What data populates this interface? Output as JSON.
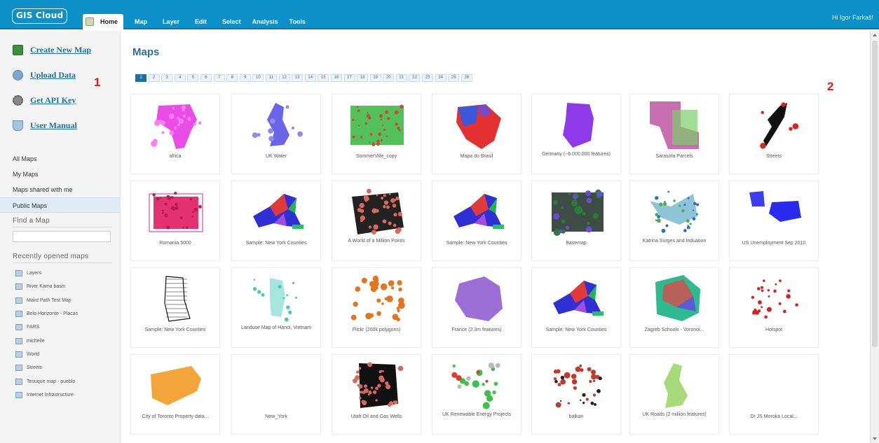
{
  "app": {
    "logo": "GIS Cloud",
    "tabs": [
      {
        "label": "Home"
      },
      {
        "label": "Map"
      },
      {
        "label": "Layer"
      },
      {
        "label": "Edit"
      },
      {
        "label": "Select"
      },
      {
        "label": "Analysis"
      },
      {
        "label": "Tools"
      }
    ],
    "user_greeting": "Hi Igor Farkaš!"
  },
  "colors": {
    "accent": "#0d90c8",
    "link": "#1a6fa3",
    "marker": "#e11b1b"
  },
  "sidebar": {
    "actions": [
      {
        "label": "Create New Map",
        "icon": "create-map-icon"
      },
      {
        "label": "Upload Data",
        "icon": "upload-icon"
      },
      {
        "label": "Get API Key",
        "icon": "gear-icon"
      },
      {
        "label": "User Manual",
        "icon": "book-icon"
      }
    ],
    "marker": "1",
    "nav": [
      {
        "label": "All Maps"
      },
      {
        "label": "My Maps"
      },
      {
        "label": "Maps shared with me"
      },
      {
        "label": "Public Maps"
      }
    ],
    "find_title": "Find a Map",
    "find_value": "",
    "recent_title": "Recently opened maps",
    "recent": [
      "Layers",
      "River Kama basin",
      "Maint Path Test Map",
      "Belo Horizonte - Placas",
      "FARS",
      "michelle",
      "World",
      "Streets",
      "Tesuque map - pueblo",
      "Internet Infrastructure"
    ]
  },
  "main": {
    "title": "Maps",
    "marker": "2",
    "pages": [
      "1",
      "2",
      "3",
      "4",
      "5",
      "6",
      "7",
      "8",
      "9",
      "10",
      "11",
      "12",
      "13",
      "14",
      "15",
      "16",
      "17",
      "18",
      "19",
      "20",
      "21",
      "22",
      "23",
      "24",
      "25",
      "26"
    ],
    "current_page": "1",
    "maps": [
      "africa",
      "UK Water",
      "SommerVille_copy",
      "Mapa do Brasil",
      "Germany (~6.000.000 features)",
      "Sarasota Parcels",
      "Streets",
      "Romania 5000",
      "Sample: New York Counties",
      "A World of a Million Points",
      "Sample: New York Counties",
      "Basemap",
      "Katrina Surges and Induation",
      "US Unemployment Sep 2010",
      "Sample: New York Counties",
      "Landuse Map of Hanoi, Vietnam",
      "Flickr (200k polygons)",
      "France (2.3m features)",
      "Sample: New York Counties",
      "Zagreb Schools - Voronoi...",
      "Hotspot",
      "City of Toronto Property data...",
      "New_York",
      "Utah Oil and Gas Wells",
      "UK Renewable Energy Projects",
      "balkan",
      "UK Roads (2 million features)",
      "Dr JS Moroka Local..."
    ]
  }
}
